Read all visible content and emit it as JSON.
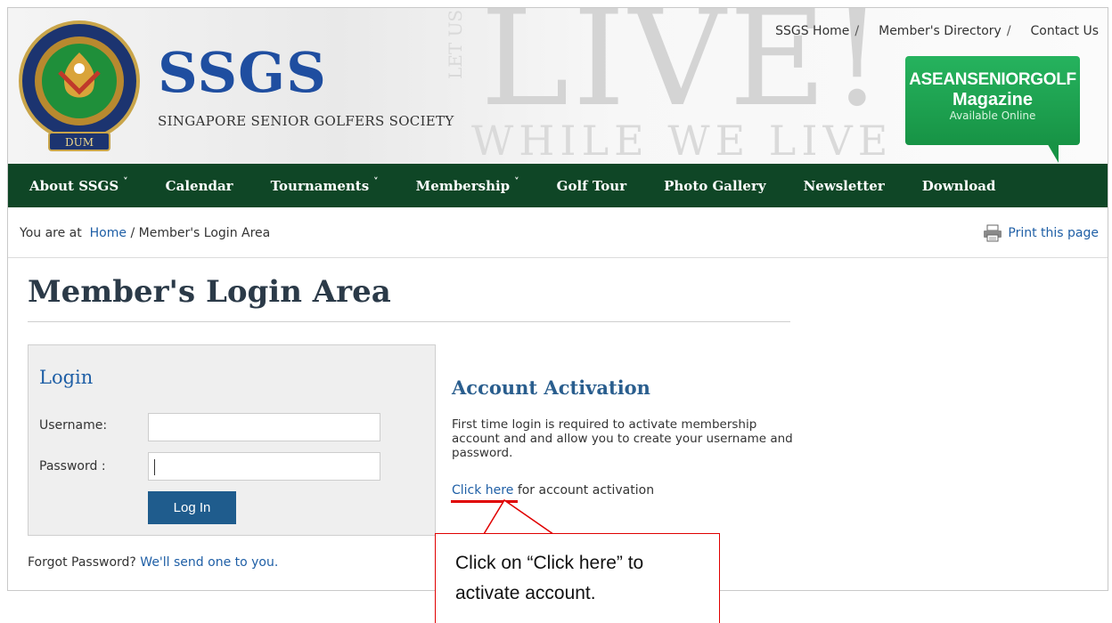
{
  "header": {
    "brand_name": "SSGS",
    "tagline": "SINGAPORE SENIOR GOLFERS SOCIETY",
    "bg_live": "LIVE!",
    "bg_while": "WHILE WE LIVE",
    "bg_letus": "LET US",
    "top_links": [
      "SSGS Home",
      "Member's Directory",
      "Contact Us"
    ],
    "separator": "/",
    "magazine": {
      "line1": "ASEANSENIORGOLF",
      "line2": "Magazine",
      "line3": "Available Online"
    },
    "seal_text": "DUM"
  },
  "nav": {
    "items": [
      {
        "label": "About SSGS",
        "dropdown": true
      },
      {
        "label": "Calendar",
        "dropdown": false
      },
      {
        "label": "Tournaments",
        "dropdown": true
      },
      {
        "label": "Membership",
        "dropdown": true
      },
      {
        "label": "Golf Tour",
        "dropdown": false
      },
      {
        "label": "Photo Gallery",
        "dropdown": false
      },
      {
        "label": "Newsletter",
        "dropdown": false
      },
      {
        "label": "Download",
        "dropdown": false
      }
    ],
    "chevron": "˅"
  },
  "breadcrumb": {
    "prefix": "You are at",
    "home": "Home",
    "separator": "/",
    "current": "Member's Login Area",
    "print_label": "Print this page"
  },
  "page_title": "Member's Login Area",
  "login": {
    "heading": "Login",
    "username_label": "Username:",
    "password_label": "Password :",
    "username_value": "",
    "password_value": "",
    "button_label": "Log In",
    "forgot_text": "Forgot Password?",
    "forgot_link": "We'll send one to you."
  },
  "activation": {
    "heading": "Account Activation",
    "description": "First time login is required to activate membership account and and allow you to create your username and password.",
    "link_label": "Click here",
    "link_suffix": "for account activation"
  },
  "callout": {
    "text": "Click on “Click here” to activate account."
  },
  "colors": {
    "nav_bg": "#0f4626",
    "brand_blue": "#1f4ea0",
    "link_blue": "#1f5fa6",
    "button_blue": "#1f5c8d",
    "annotation_red": "#e00000",
    "magazine_green": "#179345"
  }
}
